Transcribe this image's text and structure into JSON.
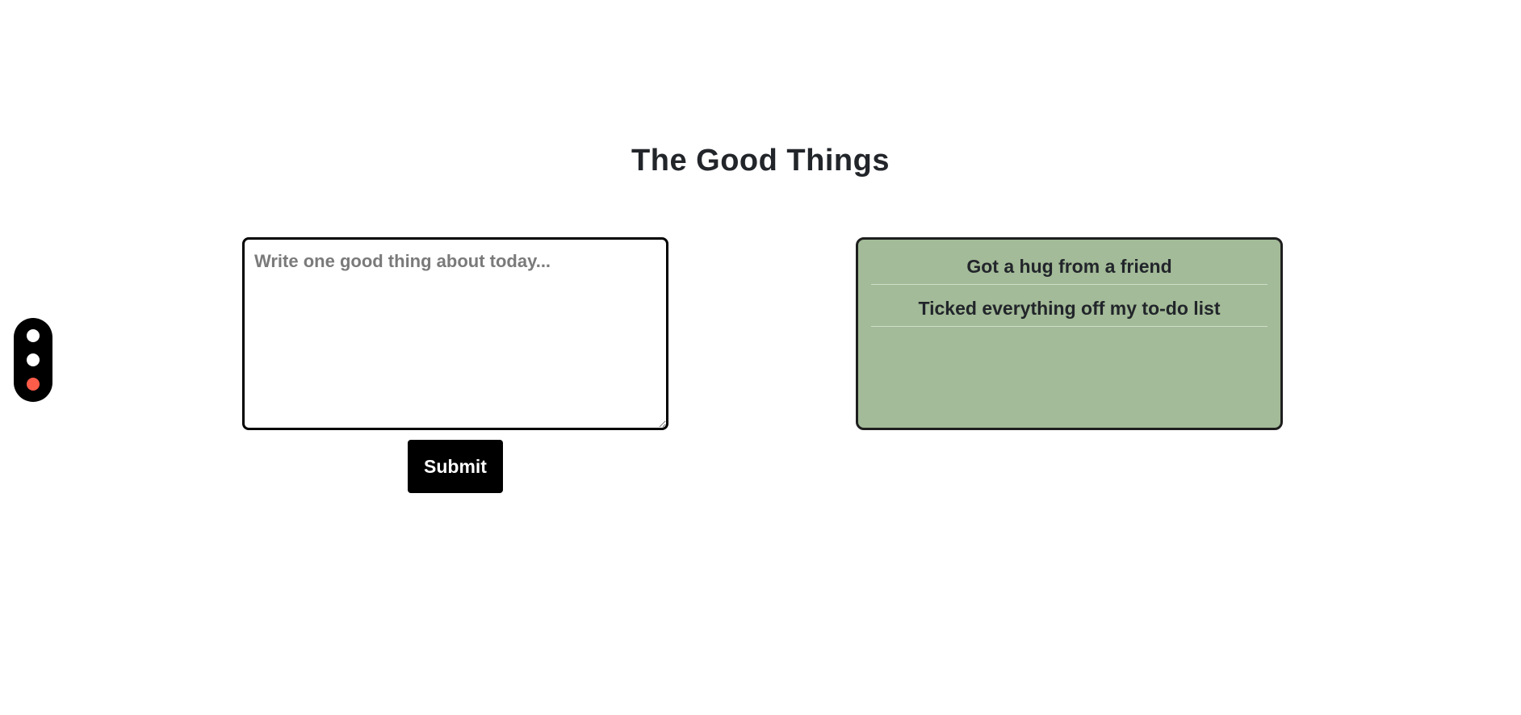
{
  "page": {
    "title": "The Good Things"
  },
  "theme_switcher": {
    "options": [
      {
        "name": "theme-1",
        "color": "#ffffff"
      },
      {
        "name": "theme-2",
        "color": "#ffffff"
      },
      {
        "name": "theme-3",
        "color": "#ff5c4a",
        "active": true
      }
    ]
  },
  "form": {
    "placeholder": "Write one good thing about today...",
    "value": "",
    "submit_label": "Submit"
  },
  "good_things": {
    "items": [
      "Got a hug from a friend",
      "Ticked everything off my to-do list"
    ],
    "panel_color": "#a3bb98"
  }
}
